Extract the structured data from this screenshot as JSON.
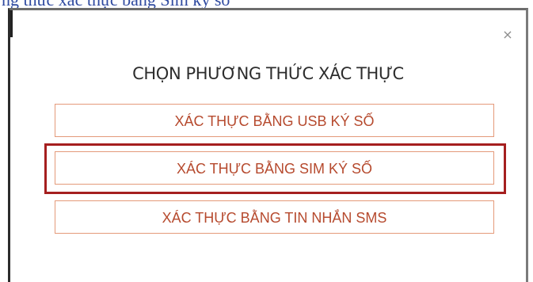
{
  "caption": {
    "text": "ng thức xác thực bằng Sim ký số"
  },
  "dialog": {
    "close_glyph": "×",
    "title": "CHỌN PHƯƠNG THỨC XÁC THỰC",
    "options": [
      {
        "label": "XÁC THỰC BẰNG USB KÝ SỐ"
      },
      {
        "label": "XÁC THỰC BẰNG SIM KÝ SỐ"
      },
      {
        "label": "XÁC THỰC BẰNG TIN NHẮN SMS"
      }
    ]
  },
  "colors": {
    "option_border": "#e49a7a",
    "option_text": "#b64a2e",
    "highlight_border": "#a51f1f",
    "caption_text": "#2f4aa0"
  },
  "icons": {
    "close": "close-icon"
  }
}
